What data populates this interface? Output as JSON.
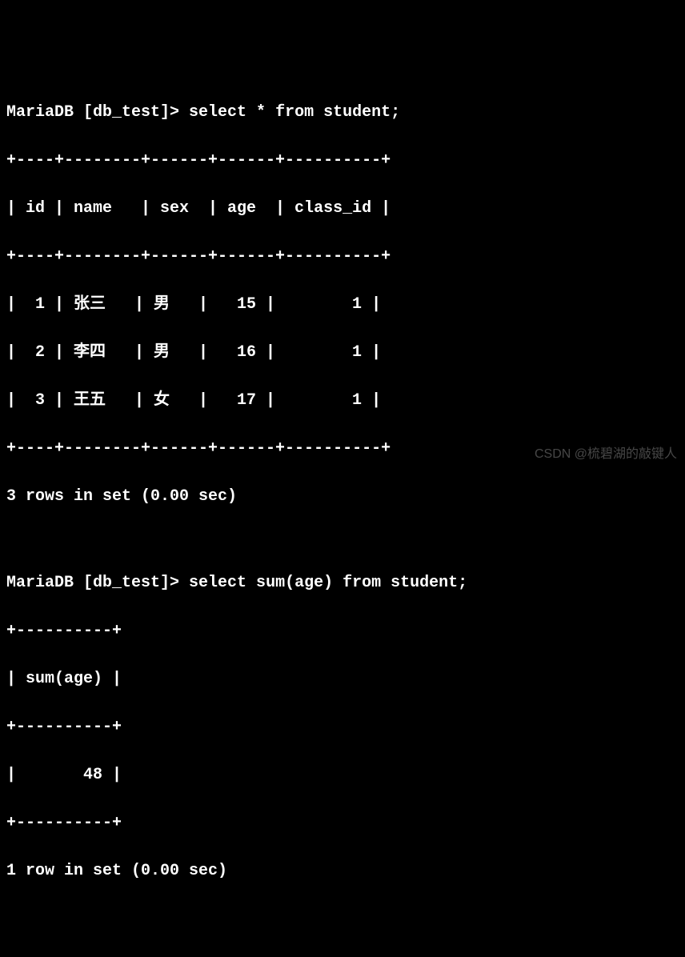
{
  "query1": {
    "prompt": "MariaDB [db_test]> ",
    "sql": "select * from student;",
    "border_top": "+----+--------+------+------+----------+",
    "header": "| id | name   | sex  | age  | class_id |",
    "border_mid": "+----+--------+------+------+----------+",
    "rows": [
      "|  1 | 张三   | 男   |   15 |        1 |",
      "|  2 | 李四   | 男   |   16 |        1 |",
      "|  3 | 王五   | 女   |   17 |        1 |"
    ],
    "border_bot": "+----+--------+------+------+----------+",
    "status": "3 rows in set (0.00 sec)"
  },
  "query2": {
    "prompt": "MariaDB [db_test]> ",
    "sql": "select sum(age) from student;",
    "border_top": "+----------+",
    "header": "| sum(age) |",
    "border_mid": "+----------+",
    "rows": [
      "|       48 |"
    ],
    "border_bot": "+----------+",
    "status": "1 row in set (0.00 sec)"
  },
  "watermark": "CSDN @梳碧湖的敲键人"
}
